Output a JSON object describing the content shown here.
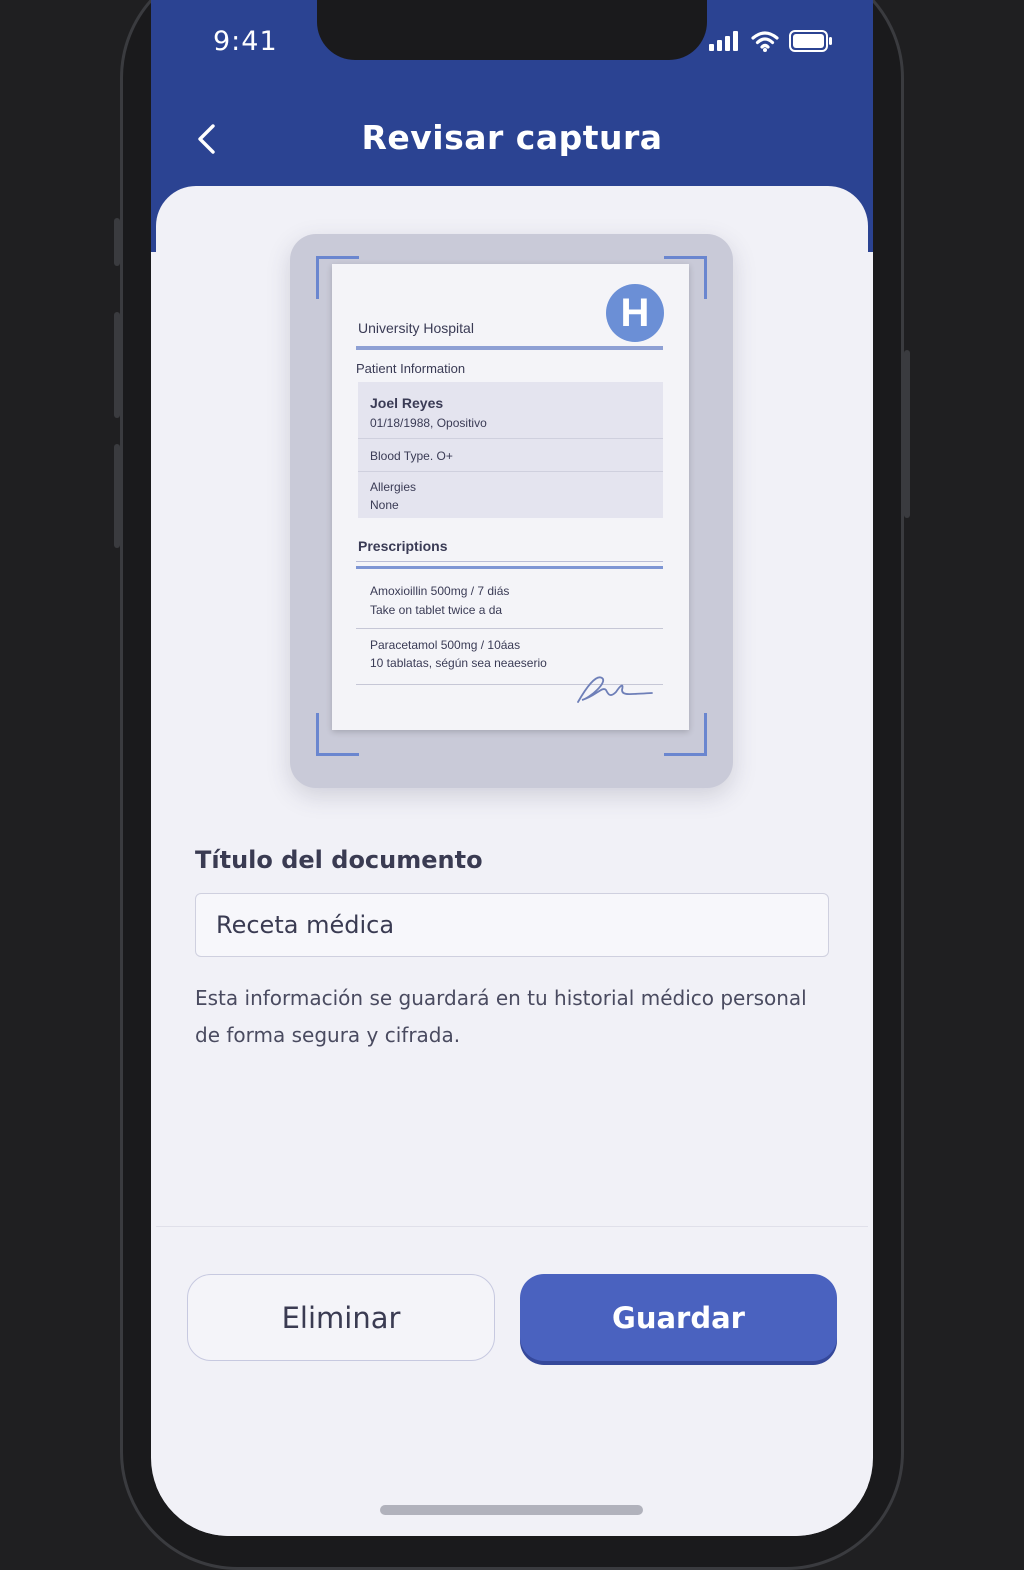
{
  "status_bar": {
    "time": "9:41"
  },
  "header": {
    "title": "Revisar captura"
  },
  "document_preview": {
    "hospital": "University Hospital",
    "logo_letter": "H",
    "section_patient": "Patient Information",
    "patient_name": "Joel Reyes",
    "patient_dob": "01/18/1988, Opositivo",
    "blood_type": "Blood Type. O+",
    "allergies_label": "Allergies",
    "allergies_value": "None",
    "section_prescriptions": "Prescriptions",
    "rx1_line1": "Amoxioillin 500mg / 7 diás",
    "rx1_line2": "Take on tablet twice a da",
    "rx2_line1": "Paracetamol 500mg / 10áas",
    "rx2_line2": "10 tablatas, ségún sea neaeserio"
  },
  "form": {
    "title_label": "Título del documento",
    "title_value": "Receta médica",
    "help_text": "Esta información se guardará en tu historial médico personal de forma segura y cifrada."
  },
  "actions": {
    "delete_label": "Eliminar",
    "save_label": "Guardar"
  },
  "colors": {
    "header": "#2b4392",
    "primary_button": "#4a62bf",
    "scan_frame": "#6a86cf"
  },
  "icons": {
    "back": "chevron-left-icon",
    "signal": "cellular-signal-icon",
    "wifi": "wifi-icon",
    "battery": "battery-icon"
  }
}
